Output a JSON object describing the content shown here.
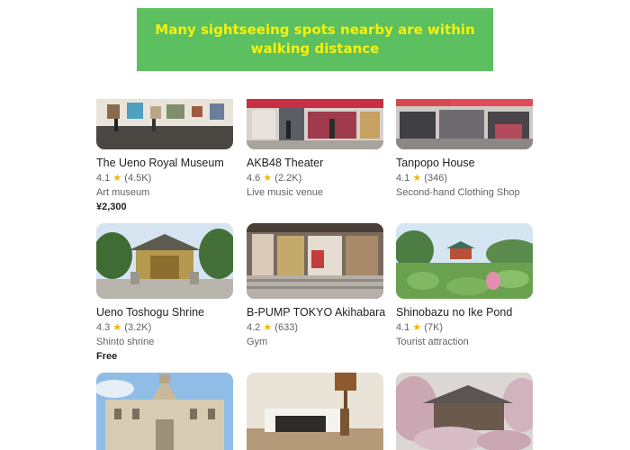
{
  "banner": {
    "line1": "Many sightseeing spots nearby are within",
    "line2": "walking distance"
  },
  "places": [
    {
      "title": "The Ueno Royal Museum",
      "rating": "4.1",
      "reviews": "(4.5K)",
      "category": "Art museum",
      "price": "¥2,300"
    },
    {
      "title": "AKB48 Theater",
      "rating": "4.6",
      "reviews": "(2.2K)",
      "category": "Live music venue",
      "price": ""
    },
    {
      "title": "Tanpopo House",
      "rating": "4.1",
      "reviews": "(346)",
      "category": "Second-hand Clothing Shop",
      "price": ""
    },
    {
      "title": "Ueno Toshogu Shrine",
      "rating": "4.3",
      "reviews": "(3.2K)",
      "category": "Shinto shrine",
      "price": "Free"
    },
    {
      "title": "B-PUMP TOKYO Akihabara",
      "rating": "4.2",
      "reviews": "(633)",
      "category": "Gym",
      "price": ""
    },
    {
      "title": "Shinobazu no Ike Pond",
      "rating": "4.1",
      "reviews": "(7K)",
      "category": "Tourist attraction",
      "price": ""
    }
  ],
  "icons": {
    "rating_star": "star-icon"
  },
  "colors": {
    "banner_bg": "#5cbf60",
    "banner_text": "#f5f10a",
    "star": "#f4b400"
  }
}
